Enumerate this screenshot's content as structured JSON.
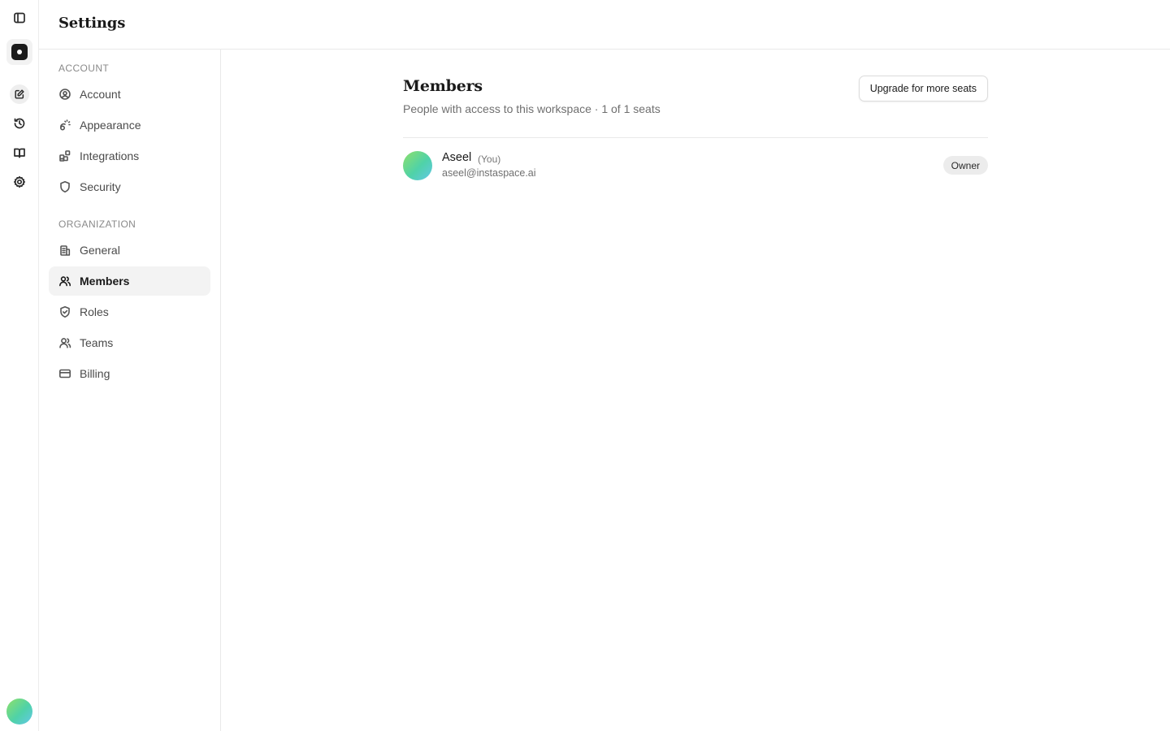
{
  "rail": {
    "icons": [
      "sidebar-toggle-icon",
      "workspace-logo-icon",
      "edit-icon",
      "history-icon",
      "book-icon",
      "gear-icon"
    ]
  },
  "header": {
    "title": "Settings"
  },
  "sidebar": {
    "account_label": "ACCOUNT",
    "account_items": [
      {
        "label": "Account",
        "icon": "user-circle-icon"
      },
      {
        "label": "Appearance",
        "icon": "palette-icon"
      },
      {
        "label": "Integrations",
        "icon": "blocks-icon"
      },
      {
        "label": "Security",
        "icon": "shield-icon"
      }
    ],
    "org_label": "ORGANIZATION",
    "org_items": [
      {
        "label": "General",
        "icon": "building-icon"
      },
      {
        "label": "Members",
        "icon": "users-icon",
        "active": true
      },
      {
        "label": "Roles",
        "icon": "shield-check-icon"
      },
      {
        "label": "Teams",
        "icon": "team-icon"
      },
      {
        "label": "Billing",
        "icon": "credit-card-icon"
      }
    ]
  },
  "main": {
    "title": "Members",
    "subtitle": "People with access to this workspace · 1 of 1 seats",
    "upgrade_label": "Upgrade for more seats",
    "members": [
      {
        "name": "Aseel",
        "you": "(You)",
        "email": "aseel@instaspace.ai",
        "role": "Owner"
      }
    ]
  },
  "colors": {
    "active_nav_bg": "#f3f3f3",
    "border": "#e9e9e9",
    "badge_bg": "#ececec",
    "avatar_gradient": [
      "#8fe06a",
      "#4fd2a8",
      "#63c8e8"
    ]
  }
}
